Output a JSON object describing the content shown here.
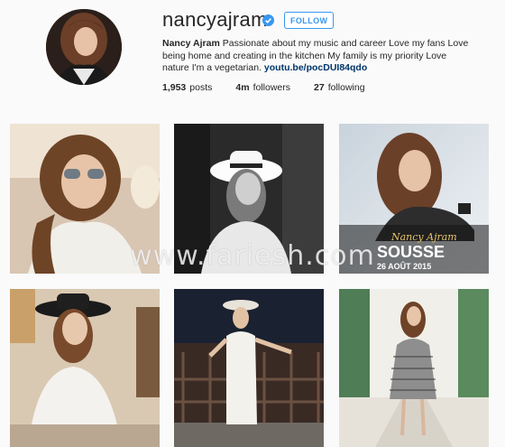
{
  "profile": {
    "username": "nancyajram",
    "follow_label": "FOLLOW",
    "bio_name": "Nancy Ajram",
    "bio_text": "Passionate about my music and career Love my fans Love being home and creating in the kitchen My family is my priority Love nature I'm a vegetarian.",
    "bio_link": "youtu.be/pocDUI84qdo",
    "posts_count": "1,953",
    "posts_label": "posts",
    "followers_count": "4m",
    "followers_label": "followers",
    "following_count": "27",
    "following_label": "following"
  },
  "posts": {
    "p3_caption_name": "Nancy Ajram",
    "p3_caption_city": "SOUSSE",
    "p3_caption_date": "26 AOÛT 2015"
  },
  "watermark": "www.fariesh.com",
  "colors": {
    "accent": "#3897f0",
    "link": "#003569",
    "background": "#fafafa"
  }
}
